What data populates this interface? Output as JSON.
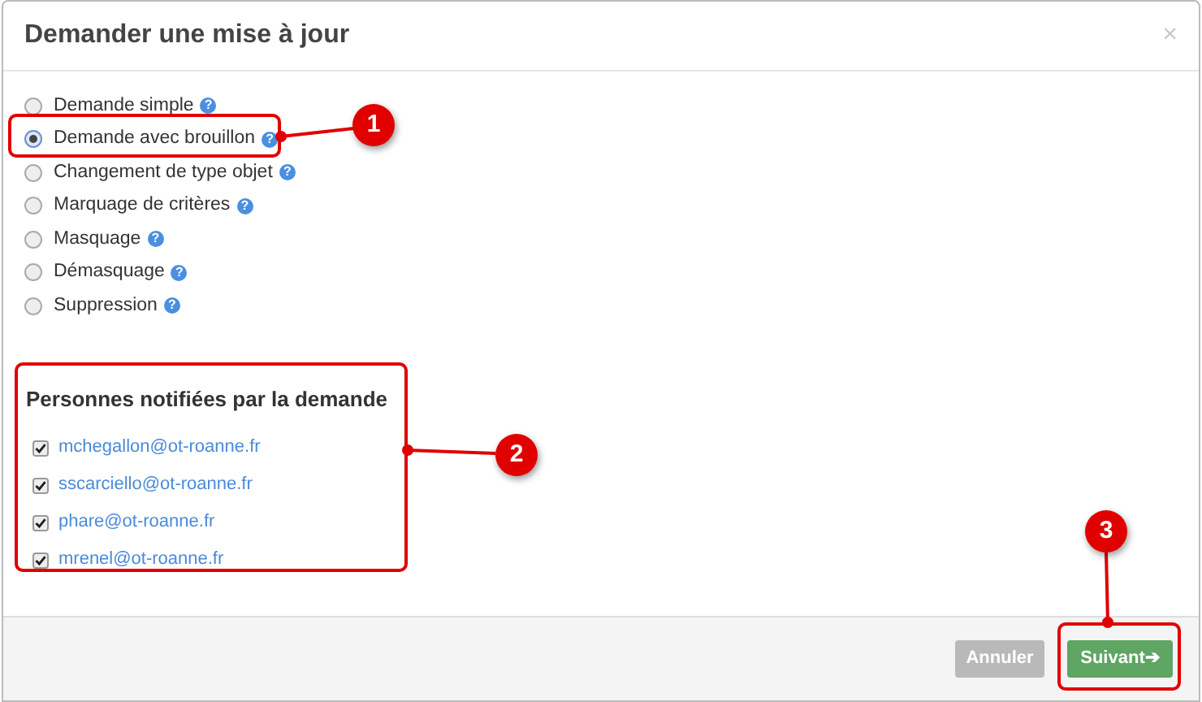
{
  "dialog": {
    "title": "Demander une mise à jour",
    "close": "×"
  },
  "options": [
    {
      "label": "Demande simple",
      "help": "?",
      "selected": false
    },
    {
      "label": "Demande avec brouillon",
      "help": "?",
      "selected": true
    },
    {
      "label": "Changement de type objet",
      "help": "?",
      "selected": false
    },
    {
      "label": "Marquage de critères",
      "help": "?",
      "selected": false
    },
    {
      "label": "Masquage",
      "help": "?",
      "selected": false
    },
    {
      "label": "Démasquage",
      "help": "?",
      "selected": false
    },
    {
      "label": "Suppression",
      "help": "?",
      "selected": false
    }
  ],
  "notified": {
    "heading": "Personnes notifiées par la demande",
    "people": [
      {
        "email": "mchegallon@ot-roanne.fr",
        "checked": true
      },
      {
        "email": "sscarciello@ot-roanne.fr",
        "checked": true
      },
      {
        "email": "phare@ot-roanne.fr",
        "checked": true
      },
      {
        "email": "mrenel@ot-roanne.fr",
        "checked": true
      }
    ]
  },
  "buttons": [
    {
      "label": "Annuler",
      "kind": "cancel"
    },
    {
      "label": "Suivant",
      "kind": "next",
      "icon": "➔"
    }
  ],
  "callouts": [
    "1",
    "2",
    "3"
  ]
}
